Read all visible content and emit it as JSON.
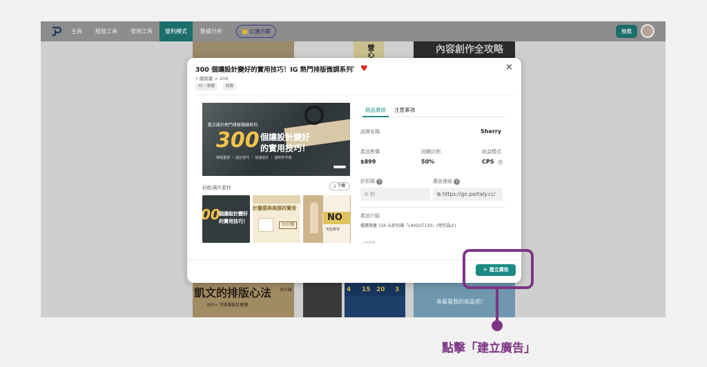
{
  "nav": {
    "items": [
      "主頁",
      "經營工具",
      "發現工具",
      "營利模式",
      "數據分析"
    ],
    "plan_button": "👑 訂閱方案",
    "right_button": "推薦"
  },
  "background": {
    "tile_top_text": "內容創作全攻略",
    "tile_side_text": "營心",
    "bottom_left_heading": "凱文的排版心法",
    "bottom_left_badge": "大升級",
    "bottom_left_sub": "300+ 字排版設計教學",
    "calendar_days": [
      "4",
      "15",
      "20",
      "3"
    ],
    "promo_text": "來看看我的商品吧！"
  },
  "modal": {
    "title": "300 個讓設計變好的實用技巧！IG 熱門排版微調系列",
    "sales": "• 總銷量 > 209",
    "tags": [
      "3C・軟體",
      "知識"
    ],
    "cover": {
      "series": "凱文設計熱門排版微調系列",
      "number": "300",
      "headline1": "個讓設計變好",
      "headline2": "的實用技巧！",
      "bullets": "排版重感 ｜ 設計技巧 ｜ 加速設計 ｜ 讓你秒字者"
    },
    "cover_label": "封面/圖片素材",
    "download_label": "下載",
    "thumbs": {
      "t1_line1": "個讓設計變好",
      "t1_line2": "的實用技巧！",
      "t2_title": "計靈感與美感的實用",
      "t2_badge": "30分鐘",
      "t4_title": "NO",
      "t4_sub": "可拉拿字"
    },
    "tabs": [
      "商品資訊",
      "注意事項"
    ],
    "brand_label": "品牌名稱",
    "brand_value": "Sherry",
    "price_label": "產品售價",
    "price_value": "$899",
    "commission_label": "回饋比例",
    "commission_value": "50%",
    "model_label": "收益模式",
    "model_value": "CPS",
    "discount_label": "折扣碼",
    "discount_value": "無",
    "link_label": "廣告連結",
    "link_value": "https://go.portaly.cc/",
    "intro_label": "產品介紹",
    "intro_text": "優惠限量 150 元折扣碼「LAYOUT150」(用完為止)",
    "more": "...more",
    "create_button": "＋ 建立廣告",
    "close": "×"
  },
  "annotation": {
    "caption": "點擊「建立廣告」",
    "color": "#7c3585"
  },
  "colors": {
    "accent": "#1c8a84",
    "nav_active": "#1c6e6b",
    "heart": "#d7281f"
  }
}
